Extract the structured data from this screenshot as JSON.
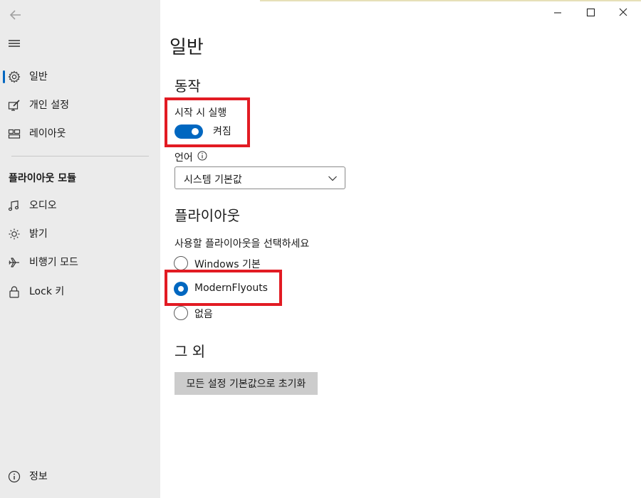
{
  "window": {
    "controls": {
      "minimize_icon": "minimize-icon",
      "maximize_icon": "maximize-icon",
      "close_icon": "close-icon"
    }
  },
  "sidebar": {
    "back_icon": "back-arrow-icon",
    "menu_icon": "hamburger-menu-icon",
    "items": [
      {
        "label": "일반",
        "icon": "gear-icon",
        "selected": true
      },
      {
        "label": "개인 설정",
        "icon": "personalize-icon",
        "selected": false
      },
      {
        "label": "레이아웃",
        "icon": "layout-icon",
        "selected": false
      }
    ],
    "section_header": "플라이아웃 모듈",
    "modules": [
      {
        "label": "오디오",
        "icon": "music-note-icon"
      },
      {
        "label": "밝기",
        "icon": "sun-icon"
      },
      {
        "label": "비행기 모드",
        "icon": "airplane-icon"
      },
      {
        "label": "Lock 키",
        "icon": "lock-icon"
      }
    ],
    "footer_item": {
      "label": "정보",
      "icon": "info-icon"
    }
  },
  "main": {
    "title": "일반",
    "behavior": {
      "title": "동작",
      "startup_label": "시작 시 실행",
      "startup_toggle_state": "켜짐",
      "startup_on": true,
      "language_label": "언어",
      "language_value": "시스템 기본값"
    },
    "flyout": {
      "title": "플라이아웃",
      "prompt": "사용할 플라이아웃을 선택하세요",
      "options": [
        {
          "label": "Windows 기본",
          "checked": false
        },
        {
          "label": "ModernFlyouts",
          "checked": true
        },
        {
          "label": "없음",
          "checked": false
        }
      ]
    },
    "other": {
      "title": "그 외",
      "reset_button": "모든 설정 기본값으로 초기화"
    }
  },
  "colors": {
    "accent": "#0067c0",
    "highlight": "#e21b23",
    "sidebar_bg": "#ebebeb",
    "button_bg": "#cccccc"
  }
}
